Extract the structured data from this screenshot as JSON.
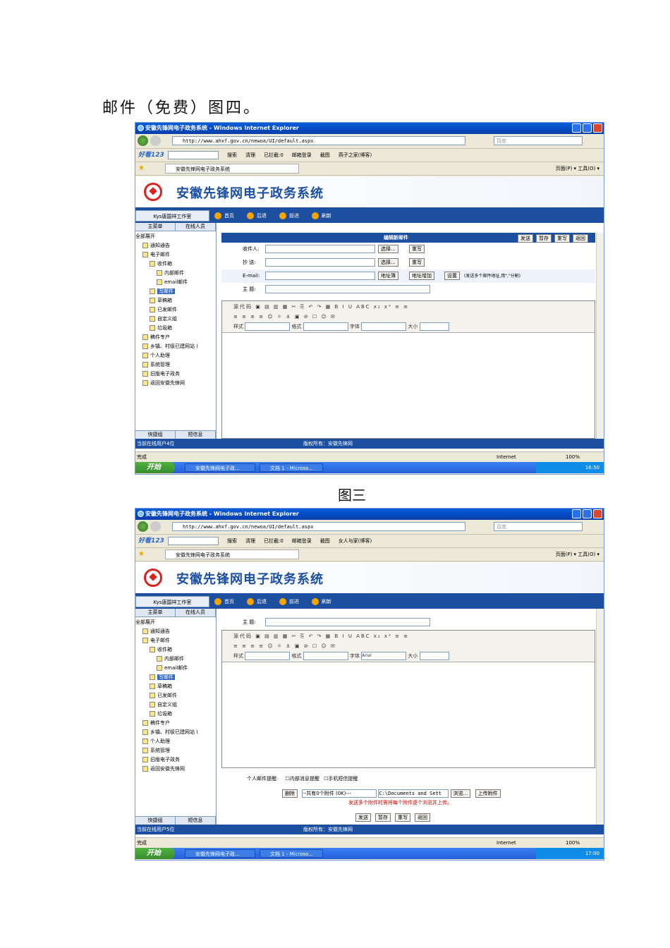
{
  "heading": "邮件（免费）图四。",
  "caption": "图三",
  "shots": [
    {
      "window_title": "安徽先锋网电子政务系统 - Windows Internet Explorer",
      "url": "http://www.ahxf.gov.cn/newoa/UI/default.aspx",
      "search_placeholder": "百度",
      "toolbar_logo": "好看123",
      "toolbar_items": [
        "搜索",
        "清理",
        "已拦截:0",
        "邮箱登录",
        "截图",
        "燕子之家(博客)"
      ],
      "tab_title": "安徽先锋网电子政务系统",
      "fav_right": "页面(P) ▾  工具(O) ▾",
      "system_name": "安徽先锋网电子政务系统",
      "org": "Kys唐国祥工作室",
      "nav_links": [
        "首页",
        "后退",
        "前进",
        "刷新"
      ],
      "side_tabs": [
        "主菜单",
        "在线人员"
      ],
      "side_bottom": [
        "快捷组",
        "短信息"
      ],
      "compose_title": "编辑新邮件",
      "compose_buttons": [
        "发送",
        "暂存",
        "重写",
        "返回"
      ],
      "fields": {
        "to": "收件人:",
        "cc": "抄  送:",
        "email": "E-mail:",
        "subject": "主  题:",
        "select": "选择...",
        "reset": "重写",
        "addrbook": "地址簿",
        "addaddr": "地址增加",
        "settings": "设置",
        "hint": "(发送多个邮件地址,用\",\"分割)"
      },
      "editor": {
        "source": "源代码",
        "style": "样式",
        "format": "格式",
        "font": "字体",
        "size": "大小",
        "font_value": ""
      },
      "online_users": "当前在线用户4位",
      "copyright": "版权所有：安徽先锋网",
      "status_done": "完成",
      "zone": "Internet",
      "zoom": "100%",
      "start": "开始",
      "tasks": [
        "安徽先锋网电子政...",
        "文档 1 - Microso..."
      ],
      "clock": "16:50"
    },
    {
      "window_title": "安徽先锋网电子政务系统 - Windows Internet Explorer",
      "url": "http://www.ahxf.gov.cn/newoa/UI/default.aspx",
      "search_placeholder": "百度",
      "toolbar_logo": "好看123",
      "toolbar_items": [
        "搜索",
        "清理",
        "已拦截:0",
        "邮箱登录",
        "截图",
        "女人与家(博客)"
      ],
      "tab_title": "安徽先锋网电子政务系统",
      "fav_right": "页面(P) ▾  工具(O) ▾",
      "system_name": "安徽先锋网电子政务系统",
      "org": "Kys唐国祥工作室",
      "nav_links": [
        "首页",
        "后退",
        "前进",
        "刷新"
      ],
      "side_tabs": [
        "主菜单",
        "在线人员"
      ],
      "side_bottom": [
        "快捷组",
        "短信息"
      ],
      "fields": {
        "subject": "主  题:"
      },
      "editor": {
        "source": "源代码",
        "style": "样式",
        "format": "格式",
        "font": "字体",
        "size": "大小",
        "font_value": "Arial"
      },
      "reminder_label": "个人邮件提醒:",
      "reminder_opts": [
        "内部消息提醒",
        "手机短信提醒"
      ],
      "delete_btn": "删除",
      "attach_summary": "--共有0个附件 (0K)---",
      "file_path": "C:\\Documents and Sett",
      "browse_btn": "浏览...",
      "upload_btn": "上传附件",
      "attach_hint": "发送多个附件时需将每个附件逐个浏览并上传。",
      "bottom_buttons": [
        "发送",
        "暂存",
        "重写",
        "返回"
      ],
      "online_users": "当前在线用户5位",
      "copyright": "版权所有：安徽先锋网",
      "status_done": "完成",
      "zone": "Internet",
      "zoom": "100%",
      "start": "开始",
      "tasks": [
        "安徽先锋网电子政...",
        "文档 1 - Microso..."
      ],
      "clock": "17:00"
    }
  ],
  "tree": [
    {
      "label": "全部展开",
      "indent": 0
    },
    {
      "label": "通知通告",
      "indent": 1
    },
    {
      "label": "电子邮件",
      "indent": 1
    },
    {
      "label": "收件箱",
      "indent": 2
    },
    {
      "label": "内部邮件",
      "indent": 3
    },
    {
      "label": "email邮件",
      "indent": 3
    },
    {
      "label": "写邮件",
      "indent": 2,
      "selected": true
    },
    {
      "label": "草稿箱",
      "indent": 2
    },
    {
      "label": "已发邮件",
      "indent": 2
    },
    {
      "label": "自定义组",
      "indent": 2
    },
    {
      "label": "垃圾箱",
      "indent": 2
    },
    {
      "label": "稿件专户",
      "indent": 1
    },
    {
      "label": "乡镇、村级已建网站 (",
      "indent": 1
    },
    {
      "label": "个人助理",
      "indent": 1
    },
    {
      "label": "系统管理",
      "indent": 1
    },
    {
      "label": "旧版电子政务",
      "indent": 1
    },
    {
      "label": "返回安徽先锋网",
      "indent": 1
    }
  ]
}
